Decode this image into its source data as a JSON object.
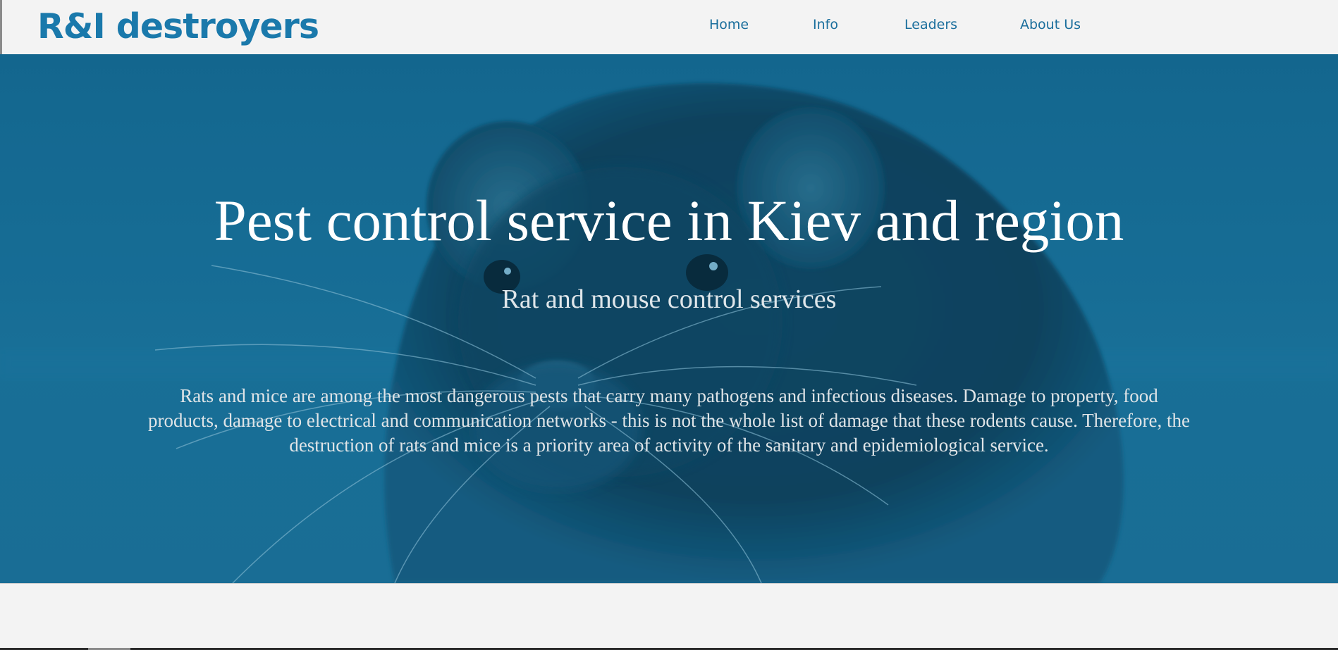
{
  "header": {
    "logo_text": "R&I destroyers",
    "nav": {
      "home": "Home",
      "info": "Info",
      "leaders": "Leaders",
      "about": "About Us"
    }
  },
  "hero": {
    "title": "Pest control service in Kiev and region",
    "subtitle": "Rat and mouse control services",
    "description": "Rats and mice are among the most dangerous pests that carry many pathogens and infectious diseases. Damage to property, food products, damage to electrical and communication networks - this is not the whole list of damage that these rodents cause. Therefore, the destruction of rats and mice is a priority area of activity of the sanitary and epidemiological service.",
    "background_image": "rat-photo"
  },
  "colors": {
    "brand": "#1a79ab",
    "hero_overlay": "#17698f",
    "page_background": "#f3f3f3"
  }
}
